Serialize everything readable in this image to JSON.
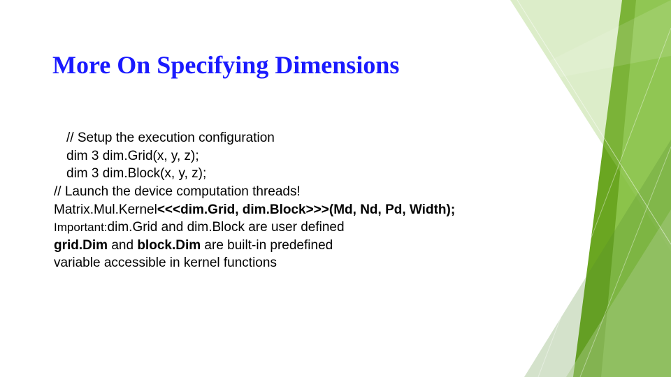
{
  "title": "More On Specifying Dimensions",
  "lines": {
    "l1": "// Setup the execution configuration",
    "l2": "dim 3 dim.Grid(x, y, z);",
    "l3": "dim 3 dim.Block(x, y, z);",
    "l4": "// Launch the device computation threads!",
    "l5_pre": "Matrix.Mul.Kernel",
    "l5_mid": "<<<dim.Grid, dim.Block>>>(Md, Nd, Pd, Width);",
    "l6_pre": "Important:",
    "l6_post": "dim.Grid and dim.Block are user defined",
    "l7_a": "grid.Dim",
    "l7_b": " and ",
    "l7_c": "block.Dim",
    "l7_d": " are built-in predefined",
    "l8": "variable accessible in kernel functions"
  }
}
